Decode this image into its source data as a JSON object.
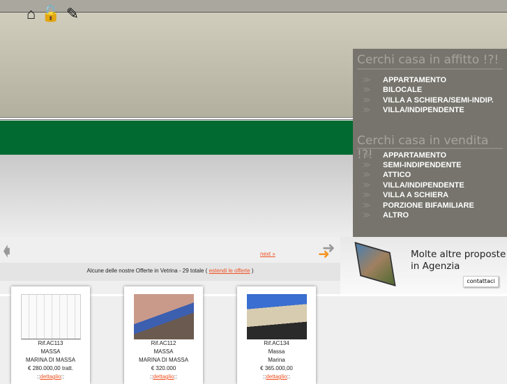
{
  "icons": [
    "home-icon",
    "lock-icon",
    "edit-icon"
  ],
  "rent": {
    "title": "Cerchi casa in affitto !?!",
    "items": [
      "APPARTAMENTO",
      "BILOCALE",
      "VILLA A SCHIERA/SEMI-INDIP.",
      "VILLA/INDIPENDENTE"
    ]
  },
  "sale": {
    "title": "Cerchi casa in vendita !?!",
    "items": [
      "APPARTAMENTO",
      "SEMI-INDIPENDENTE",
      "ATTICO",
      "VILLA/INDIPENDENTE",
      "VILLA A SCHIERA",
      "PORZIONE BIFAMILIARE",
      "ALTRO"
    ]
  },
  "nav": {
    "next": "next »"
  },
  "offers": {
    "text": "Alcune delle nostre Offerte in Vetrina - 29 totale (",
    "link": "estendi le offerte",
    "close": ")"
  },
  "promo": {
    "line1": "Molte altre proposte",
    "line2": "in Agenzia",
    "button": "contattaci"
  },
  "cards": [
    {
      "ref": "Rif.AC113",
      "city": "MASSA",
      "zone": "MARINA DI MASSA",
      "price": "€ 280.000,00 tratt.",
      "link": "dettaglio"
    },
    {
      "ref": "Rif.AC112",
      "city": "MASSA",
      "zone": "MARINA DI MASSA",
      "price": "€ 320.000",
      "link": "dettaglio"
    },
    {
      "ref": "Rif.AC134",
      "city": "Massa",
      "zone": "Marina",
      "price": "€ 365.000,00",
      "link": "dettaglio"
    }
  ]
}
